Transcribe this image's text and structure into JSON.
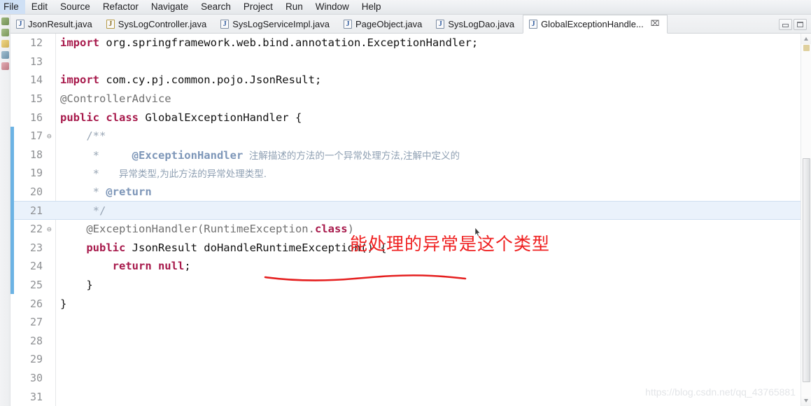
{
  "menubar": {
    "items": [
      {
        "label": "File"
      },
      {
        "label": "Edit"
      },
      {
        "label": "Source"
      },
      {
        "label": "Refactor"
      },
      {
        "label": "Navigate"
      },
      {
        "label": "Search"
      },
      {
        "label": "Project"
      },
      {
        "label": "Run"
      },
      {
        "label": "Window"
      },
      {
        "label": "Help"
      }
    ]
  },
  "tabs": [
    {
      "label": "JsonResult.java",
      "active": false,
      "icon": "java-file-icon"
    },
    {
      "label": "SysLogController.java",
      "active": false,
      "icon": "java-file-warning-icon"
    },
    {
      "label": "SysLogServiceImpl.java",
      "active": false,
      "icon": "java-file-icon"
    },
    {
      "label": "PageObject.java",
      "active": false,
      "icon": "java-file-icon"
    },
    {
      "label": "SysLogDao.java",
      "active": false,
      "icon": "java-file-icon"
    },
    {
      "label": "GlobalExceptionHandle...",
      "active": true,
      "icon": "java-file-icon",
      "close": "⌧"
    }
  ],
  "window_controls": {
    "minimize": "minimize-button",
    "maximize": "maximize-button"
  },
  "editor": {
    "lines": [
      {
        "num": "12",
        "fold": "",
        "highlight": false,
        "gutter": false,
        "tokens": [
          {
            "t": "import",
            "c": "kw"
          },
          {
            "t": " org.springframework.web.bind.annotation.ExceptionHandler;",
            "c": "plain"
          }
        ]
      },
      {
        "num": "13",
        "fold": "",
        "highlight": false,
        "gutter": false,
        "tokens": []
      },
      {
        "num": "14",
        "fold": "",
        "highlight": false,
        "gutter": false,
        "tokens": [
          {
            "t": "import",
            "c": "kw"
          },
          {
            "t": " com.cy.pj.common.pojo.JsonResult;",
            "c": "plain"
          }
        ]
      },
      {
        "num": "15",
        "fold": "",
        "highlight": false,
        "gutter": false,
        "tokens": [
          {
            "t": "@ControllerAdvice",
            "c": "ann"
          }
        ]
      },
      {
        "num": "16",
        "fold": "",
        "highlight": false,
        "gutter": false,
        "tokens": [
          {
            "t": "public class",
            "c": "kw"
          },
          {
            "t": " GlobalExceptionHandler {",
            "c": "plain"
          }
        ]
      },
      {
        "num": "17",
        "fold": "⊖",
        "highlight": false,
        "gutter": true,
        "tokens": [
          {
            "t": "    /**",
            "c": "cmt"
          }
        ]
      },
      {
        "num": "18",
        "fold": "",
        "highlight": false,
        "gutter": true,
        "tokens": [
          {
            "t": "     *     ",
            "c": "cmt"
          },
          {
            "t": "@ExceptionHandler",
            "c": "cmt-tag"
          },
          {
            "t": "  注解描述的方法的一个异常处理方法,注解中定义的",
            "c": "cmt-cn"
          }
        ]
      },
      {
        "num": "19",
        "fold": "",
        "highlight": false,
        "gutter": true,
        "tokens": [
          {
            "t": "     *   ",
            "c": "cmt"
          },
          {
            "t": "异常类型,为此方法的异常处理类型.",
            "c": "cmt-cn"
          }
        ]
      },
      {
        "num": "20",
        "fold": "",
        "highlight": false,
        "gutter": true,
        "tokens": [
          {
            "t": "     * ",
            "c": "cmt"
          },
          {
            "t": "@return",
            "c": "cmt-tag"
          }
        ]
      },
      {
        "num": "21",
        "fold": "",
        "highlight": true,
        "gutter": true,
        "tokens": [
          {
            "t": "     */",
            "c": "cmt"
          }
        ]
      },
      {
        "num": "22",
        "fold": "⊖",
        "highlight": false,
        "gutter": true,
        "tokens": [
          {
            "t": "    @ExceptionHandler(RuntimeException.",
            "c": "ann"
          },
          {
            "t": "class",
            "c": "fld"
          },
          {
            "t": ")",
            "c": "ann"
          }
        ]
      },
      {
        "num": "23",
        "fold": "",
        "highlight": false,
        "gutter": true,
        "tokens": [
          {
            "t": "    ",
            "c": "plain"
          },
          {
            "t": "public",
            "c": "kw"
          },
          {
            "t": " JsonResult doHandleRuntimeException() {",
            "c": "plain"
          }
        ]
      },
      {
        "num": "24",
        "fold": "",
        "highlight": false,
        "gutter": true,
        "tokens": [
          {
            "t": "        ",
            "c": "plain"
          },
          {
            "t": "return null",
            "c": "kw"
          },
          {
            "t": ";",
            "c": "plain"
          }
        ]
      },
      {
        "num": "25",
        "fold": "",
        "highlight": false,
        "gutter": true,
        "tokens": [
          {
            "t": "    }",
            "c": "plain"
          }
        ]
      },
      {
        "num": "26",
        "fold": "",
        "highlight": false,
        "gutter": false,
        "tokens": [
          {
            "t": "}",
            "c": "plain"
          }
        ]
      },
      {
        "num": "27",
        "fold": "",
        "highlight": false,
        "gutter": false,
        "tokens": []
      },
      {
        "num": "28",
        "fold": "",
        "highlight": false,
        "gutter": false,
        "tokens": []
      },
      {
        "num": "29",
        "fold": "",
        "highlight": false,
        "gutter": false,
        "tokens": []
      },
      {
        "num": "30",
        "fold": "",
        "highlight": false,
        "gutter": false,
        "tokens": []
      },
      {
        "num": "31",
        "fold": "",
        "highlight": false,
        "gutter": false,
        "tokens": []
      }
    ]
  },
  "annotations": {
    "red_note": "能处理的异常是这个类型",
    "red_color": "#ef2020",
    "underline_target": "(RuntimeException.class)"
  },
  "watermark": {
    "text": "https://blog.csdn.net/qq_43765881"
  },
  "left_strip": {
    "icons": [
      "package-explorer-icon",
      "type-hierarchy-icon",
      "folder-icon",
      "outline-icon",
      "bookmark-icon"
    ]
  },
  "colors": {
    "current_line_highlight": "#eaf2fb",
    "keyword": "#a7194b",
    "comment": "#9aa7b6",
    "gutter_mark": "#6cb3e4"
  }
}
